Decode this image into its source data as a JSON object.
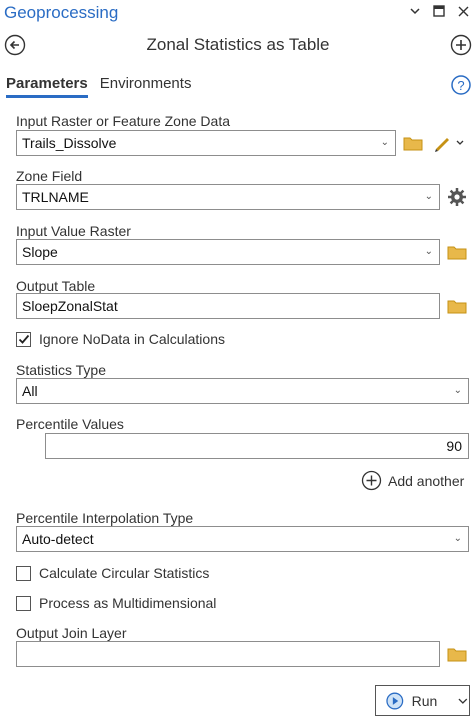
{
  "pane": {
    "title": "Geoprocessing"
  },
  "tool": {
    "title": "Zonal Statistics as Table"
  },
  "tabs": [
    {
      "label": "Parameters"
    },
    {
      "label": "Environments"
    }
  ],
  "params": {
    "input_zone": {
      "label": "Input Raster or Feature Zone Data",
      "value": "Trails_Dissolve"
    },
    "zone_field": {
      "label": "Zone Field",
      "value": "TRLNAME"
    },
    "value_raster": {
      "label": "Input Value Raster",
      "value": "Slope"
    },
    "output_table": {
      "label": "Output Table",
      "value": "SloepZonalStat"
    },
    "ignore_nodata": {
      "label": "Ignore NoData in Calculations",
      "checked": true
    },
    "stats_type": {
      "label": "Statistics Type",
      "value": "All"
    },
    "percentile_values": {
      "label": "Percentile Values",
      "value": "90",
      "add_label": "Add another"
    },
    "interp_type": {
      "label": "Percentile Interpolation Type",
      "value": "Auto-detect"
    },
    "circular": {
      "label": "Calculate Circular Statistics",
      "checked": false
    },
    "multidim": {
      "label": "Process as Multidimensional",
      "checked": false
    },
    "join_layer": {
      "label": "Output Join Layer",
      "value": ""
    }
  },
  "run": {
    "label": "Run"
  },
  "colors": {
    "accent": "#2a6cc4",
    "folder": "#e8b84a",
    "pencil": "#c69214"
  }
}
